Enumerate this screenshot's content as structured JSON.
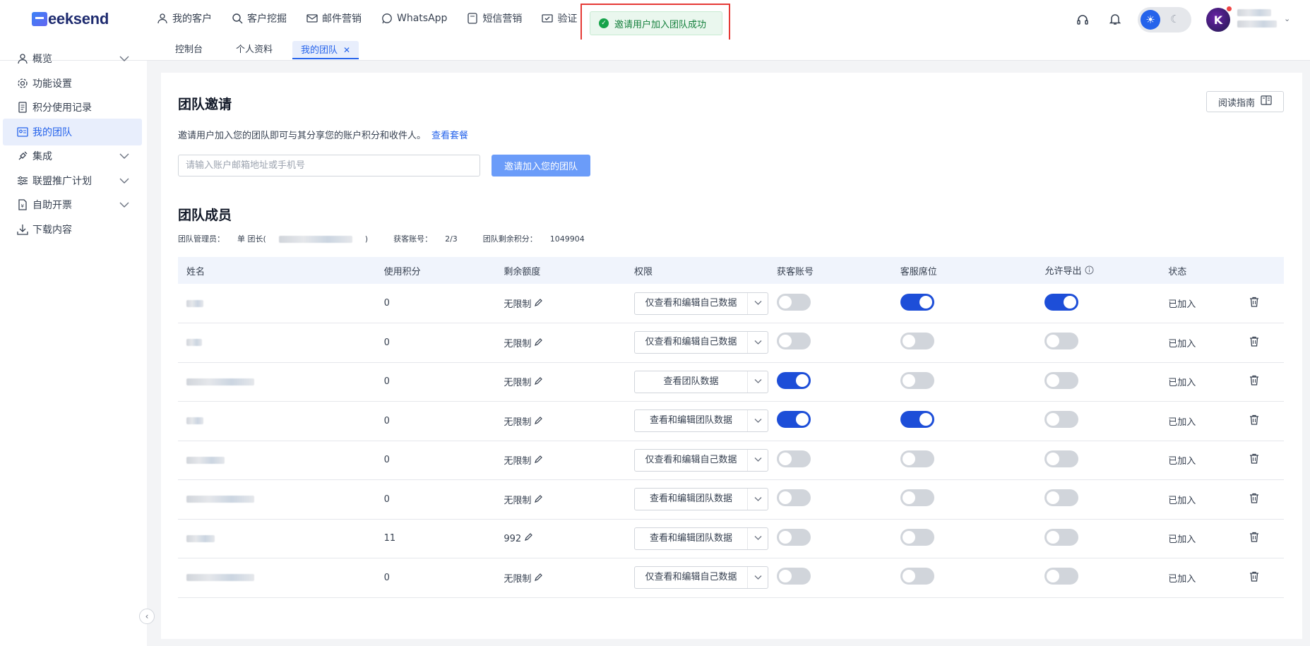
{
  "app": {
    "logo": "Geeksend",
    "logo_text": "eeksend"
  },
  "topnav": [
    {
      "label": "我的客户",
      "icon": "user-icon"
    },
    {
      "label": "客户挖掘",
      "icon": "search-icon"
    },
    {
      "label": "邮件营销",
      "icon": "mail-icon"
    },
    {
      "label": "WhatsApp",
      "icon": "whatsapp-icon"
    },
    {
      "label": "短信营销",
      "icon": "sms-icon"
    },
    {
      "label": "验证",
      "icon": "verify-icon"
    }
  ],
  "toast": {
    "message": "邀请用户加入团队成功"
  },
  "page_tabs": [
    {
      "label": "控制台"
    },
    {
      "label": "个人资料"
    },
    {
      "label": "我的团队",
      "active": true
    }
  ],
  "sidebar": [
    {
      "label": "概览",
      "icon": "user-icon",
      "expandable": true
    },
    {
      "label": "功能设置",
      "icon": "gear-icon"
    },
    {
      "label": "积分使用记录",
      "icon": "document-icon"
    },
    {
      "label": "我的团队",
      "icon": "team-card-icon",
      "active": true
    },
    {
      "label": "集成",
      "icon": "plug-icon",
      "expandable": true
    },
    {
      "label": "联盟推广计划",
      "icon": "sliders-icon",
      "expandable": true
    },
    {
      "label": "自助开票",
      "icon": "invoice-icon",
      "expandable": true
    },
    {
      "label": "下载内容",
      "icon": "download-icon"
    }
  ],
  "invite": {
    "title": "团队邀请",
    "description": "邀请用户加入您的团队即可与其分享您的账户积分和收件人。",
    "link": "查看套餐",
    "placeholder": "请输入账户邮箱地址或手机号",
    "button": "邀请加入您的团队",
    "guide_button": "阅读指南"
  },
  "members": {
    "title": "团队成员",
    "manager_label": "团队管理员：",
    "manager_value": "单 团长(",
    "manager_close": ")",
    "accounts_label": "获客账号：",
    "accounts_value": "2/3",
    "points_label": "团队剩余积分：",
    "points_value": "1049904",
    "columns": [
      "姓名",
      "使用积分",
      "剩余额度",
      "权限",
      "获客账号",
      "客服席位",
      "允许导出",
      "状态"
    ],
    "rows": [
      {
        "used": "0",
        "remaining": "无限制",
        "permission": "仅查看和编辑自己数据",
        "acquire": false,
        "service": true,
        "export": true,
        "status": "已加入"
      },
      {
        "used": "0",
        "remaining": "无限制",
        "permission": "仅查看和编辑自己数据",
        "acquire": false,
        "service": false,
        "export": false,
        "status": "已加入"
      },
      {
        "used": "0",
        "remaining": "无限制",
        "permission": "查看团队数据",
        "acquire": true,
        "service": false,
        "export": false,
        "status": "已加入"
      },
      {
        "used": "0",
        "remaining": "无限制",
        "permission": "查看和编辑团队数据",
        "acquire": true,
        "service": true,
        "export": false,
        "status": "已加入"
      },
      {
        "used": "0",
        "remaining": "无限制",
        "permission": "仅查看和编辑自己数据",
        "acquire": false,
        "service": false,
        "export": false,
        "status": "已加入"
      },
      {
        "used": "0",
        "remaining": "无限制",
        "permission": "查看和编辑团队数据",
        "acquire": false,
        "service": false,
        "export": false,
        "status": "已加入"
      },
      {
        "used": "11",
        "remaining": "992",
        "permission": "查看和编辑团队数据",
        "acquire": false,
        "service": false,
        "export": false,
        "status": "已加入"
      },
      {
        "used": "0",
        "remaining": "无限制",
        "permission": "仅查看和编辑自己数据",
        "acquire": false,
        "service": false,
        "export": false,
        "status": "已加入"
      }
    ]
  },
  "colors": {
    "accent": "#2563eb",
    "toggle_on": "#1d4ed8",
    "toast_border": "#e53935",
    "success": "#16a34a"
  }
}
